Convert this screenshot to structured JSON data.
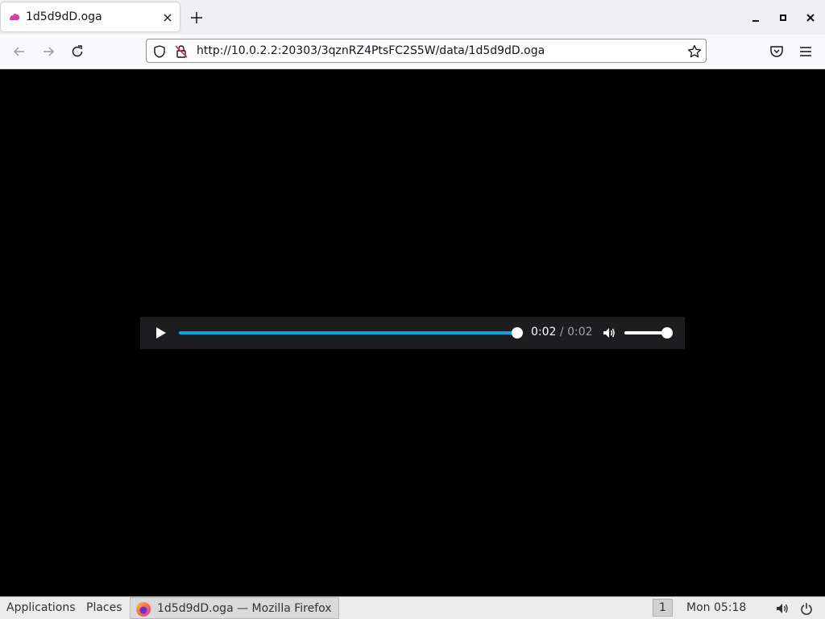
{
  "browser": {
    "tab_title": "1d5d9dD.oga",
    "url": "http://10.0.2.2:20303/3qznRZ4PtsFC2S5W/data/1d5d9dD.oga",
    "icons": {
      "favicon": "audio-file-icon",
      "new_tab": "plus-icon",
      "close_tab": "close-icon",
      "minimize": "minimize-icon",
      "maximize": "maximize-icon",
      "close_window": "close-icon",
      "back": "back-arrow-icon",
      "forward": "forward-arrow-icon",
      "reload": "reload-icon",
      "tracking": "shield-icon",
      "insecure": "insecure-lock-icon",
      "bookmark": "star-icon",
      "pocket": "pocket-icon",
      "menu": "hamburger-menu-icon"
    }
  },
  "player": {
    "state": "paused",
    "current_time": "0:02",
    "separator": "/",
    "duration": "0:02",
    "progress_fraction": 1.0,
    "volume_fraction": 1.0,
    "accent_color": "#0fa5e5"
  },
  "taskbar": {
    "applications_label": "Applications",
    "places_label": "Places",
    "window_label": "1d5d9dD.oga — Mozilla Firefox",
    "workspace": "1",
    "clock": "Mon 05:18"
  }
}
